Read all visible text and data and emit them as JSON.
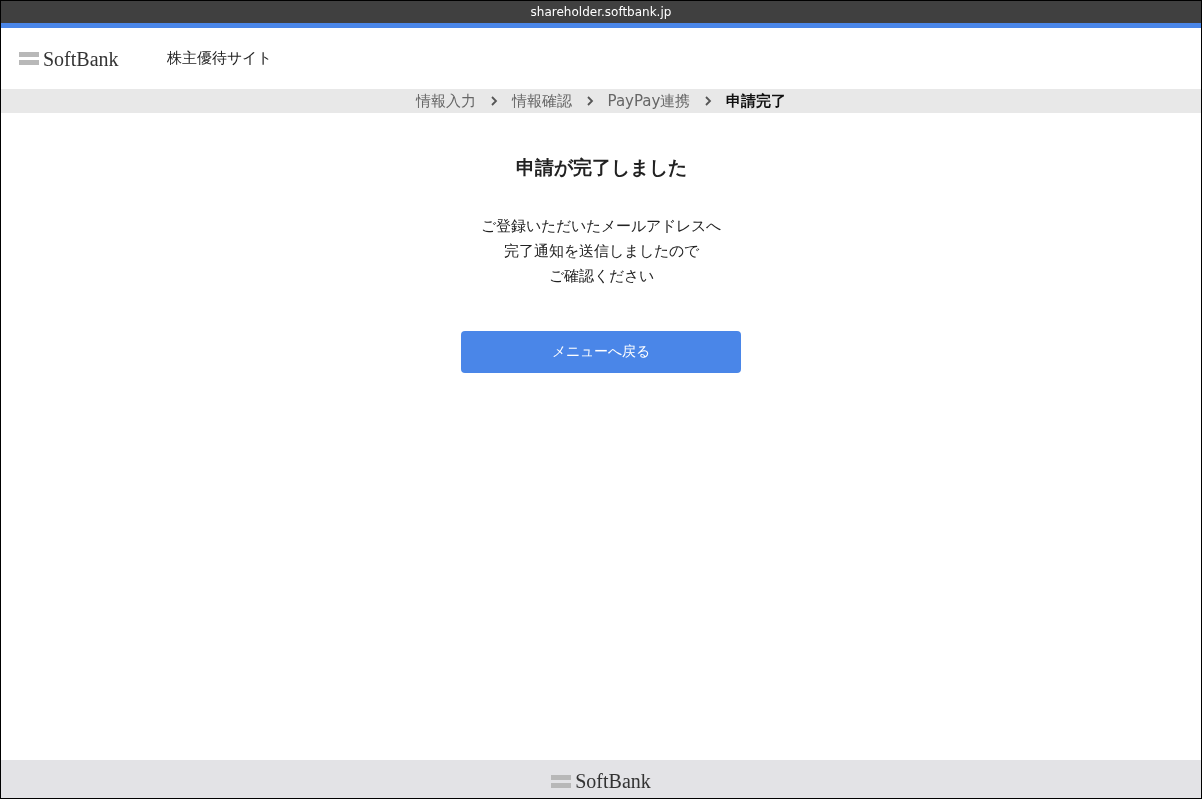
{
  "address_bar": {
    "url": "shareholder.softbank.jp"
  },
  "header": {
    "logo": "SoftBank",
    "site_title": "株主優待サイト"
  },
  "breadcrumb": [
    {
      "label": "情報入力",
      "current": false
    },
    {
      "label": "情報確認",
      "current": false
    },
    {
      "label": "PayPay連携",
      "current": false
    },
    {
      "label": "申請完了",
      "current": true
    }
  ],
  "main": {
    "heading": "申請が完了しました",
    "message_lines": [
      "ご登録いただいたメールアドレスへ",
      "完了通知を送信しましたので",
      "ご確認ください"
    ],
    "button": "メニューへ戻る"
  },
  "footer": {
    "logo": "SoftBank"
  }
}
